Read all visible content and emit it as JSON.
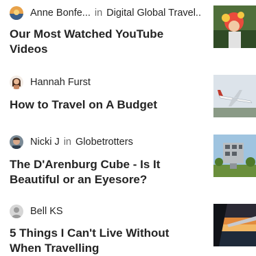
{
  "articles": [
    {
      "author": "Anne Bonfe...",
      "in_label": "in",
      "publication": "Digital Global Travel...",
      "title_line1": "Our Most Watched YouTube",
      "title_line2": "Videos",
      "avatar_icon": "avatar-orange-sunset",
      "thumbnail_icon": "person-with-flowers-photo"
    },
    {
      "author": "Hannah Furst",
      "in_label": "",
      "publication": "",
      "title_line1": "How to Travel on A Budget",
      "title_line2": "",
      "avatar_icon": "avatar-woman",
      "thumbnail_icon": "airplane-photo"
    },
    {
      "author": "Nicki J",
      "in_label": "in",
      "publication": "Globetrotters",
      "title_line1": "The D'Arenburg Cube - Is It",
      "title_line2": "Beautiful or an Eyesore?",
      "avatar_icon": "avatar-man",
      "thumbnail_icon": "cube-building-photo"
    },
    {
      "author": "Bell KS",
      "in_label": "",
      "publication": "",
      "title_line1": "5 Things I Can't Live Without",
      "title_line2": "When Travelling",
      "avatar_icon": "avatar-default-grey",
      "thumbnail_icon": "airplane-window-sunset-photo"
    }
  ],
  "colors": {
    "text": "#242424",
    "muted": "#6b6b6b",
    "background": "#ffffff"
  }
}
